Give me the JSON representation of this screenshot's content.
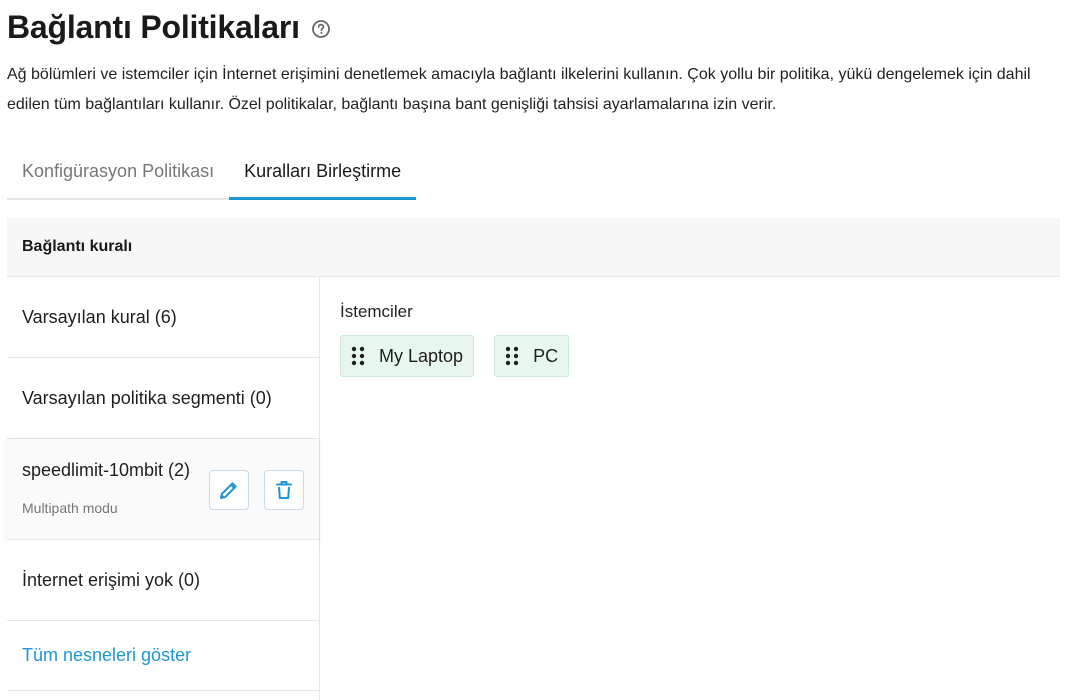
{
  "page": {
    "title": "Bağlantı Politikaları",
    "help_icon": "question-circle-icon",
    "description": "Ağ bölümleri ve istemciler için İnternet erişimini denetlemek amacıyla bağlantı ilkelerini kullanın. Çok yollu bir politika, yükü dengelemek için dahil edilen tüm bağlantıları kullanır. Özel politikalar, bağlantı başına bant genişliği tahsisi ayarlamalarına izin verir."
  },
  "tabs": [
    {
      "label": "Konfigürasyon Politikası",
      "active": false
    },
    {
      "label": "Kuralları Birleştirme",
      "active": true
    }
  ],
  "panel": {
    "header": "Bağlantı kuralı",
    "rules": [
      {
        "label": "Varsayılan kural (6)"
      },
      {
        "label": "Varsayılan politika segmenti (0)"
      },
      {
        "label": "speedlimit-10mbit (2)",
        "sub": "Multipath modu",
        "selected": true,
        "edit_icon": "pencil-icon",
        "delete_icon": "trash-icon"
      },
      {
        "label": "İnternet erişimi yok (0)"
      }
    ],
    "show_all": "Tüm nesneleri göster"
  },
  "clients": {
    "label": "İstemciler",
    "items": [
      {
        "name": "My Laptop",
        "icon": "drag-handle-icon"
      },
      {
        "name": "PC",
        "icon": "drag-handle-icon"
      }
    ]
  },
  "colors": {
    "accent": "#1e96d2",
    "chip_bg": "#e8f7ee",
    "header_bg": "#f7f7f7"
  }
}
